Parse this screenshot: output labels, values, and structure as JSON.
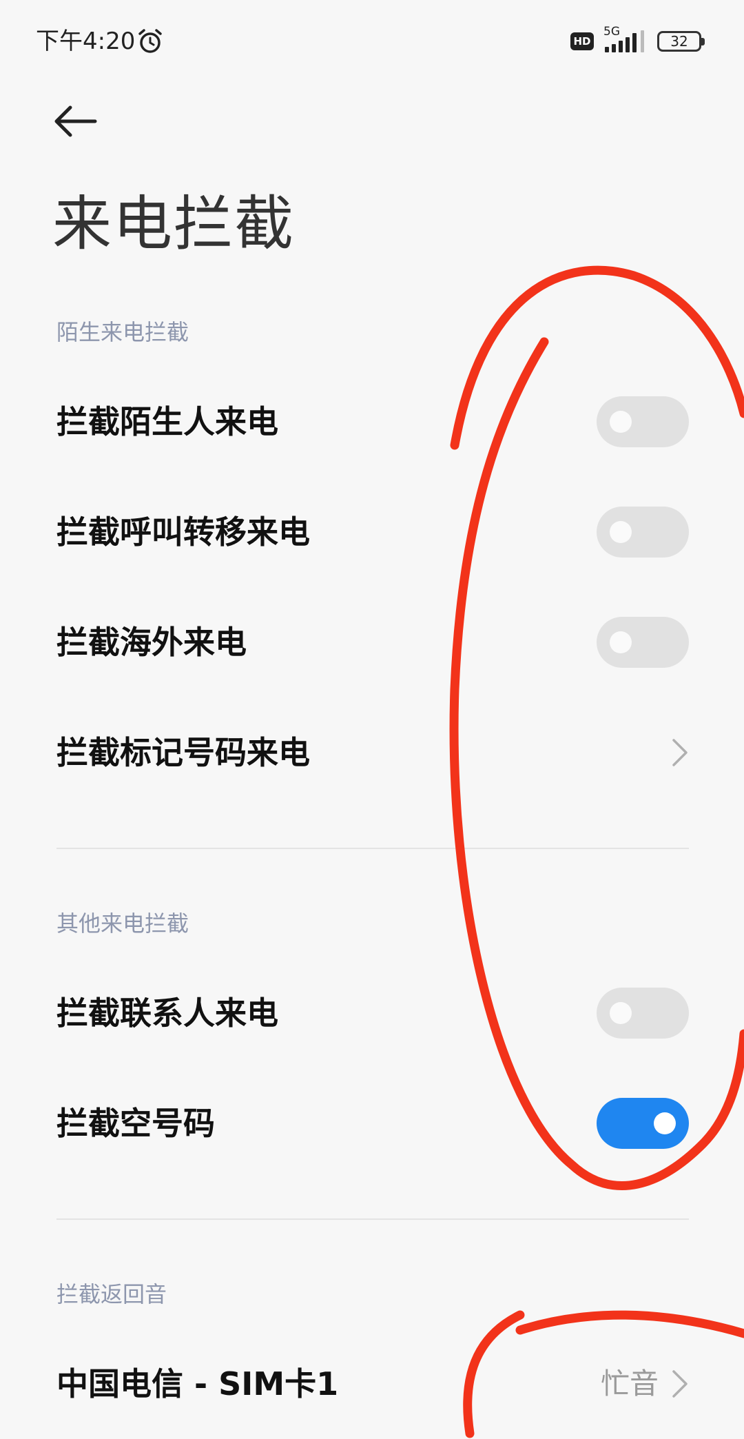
{
  "status_bar": {
    "time": "下午4:20",
    "network": "5G",
    "hd_label": "HD",
    "battery": "32",
    "icons": [
      "alarm-icon",
      "hd-badge",
      "signal-icon",
      "battery-icon"
    ]
  },
  "header": {
    "back_icon": "back-arrow-icon",
    "title": "来电拦截"
  },
  "sections": [
    {
      "header": "陌生来电拦截",
      "items": [
        {
          "label": "拦截陌生人来电",
          "type": "toggle",
          "on": false
        },
        {
          "label": "拦截呼叫转移来电",
          "type": "toggle",
          "on": false
        },
        {
          "label": "拦截海外来电",
          "type": "toggle",
          "on": false
        },
        {
          "label": "拦截标记号码来电",
          "type": "link"
        }
      ]
    },
    {
      "header": "其他来电拦截",
      "items": [
        {
          "label": "拦截联系人来电",
          "type": "toggle",
          "on": false
        },
        {
          "label": "拦截空号码",
          "type": "toggle",
          "on": true
        }
      ]
    },
    {
      "header": "拦截返回音",
      "items": [
        {
          "label": "中国电信 - SIM卡1",
          "type": "link",
          "value": "忙音"
        }
      ]
    }
  ],
  "colors": {
    "background": "#f7f7f7",
    "toggle_off": "#e1e1e1",
    "toggle_on": "#1f86f0",
    "section_header": "#8d96ad",
    "annotation": "#f2331a"
  }
}
